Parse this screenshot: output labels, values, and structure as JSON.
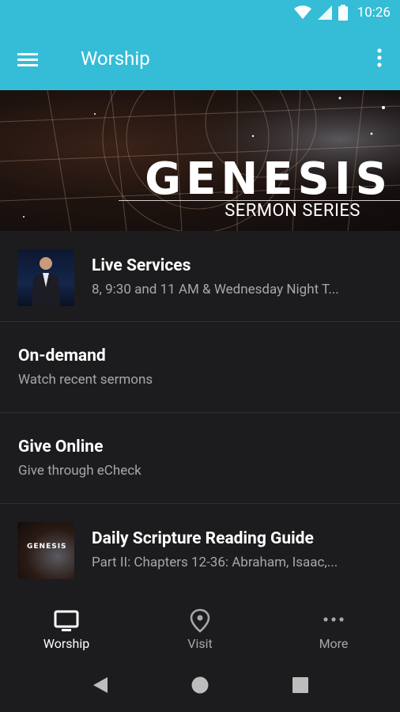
{
  "status_bar": {
    "time": "10:26"
  },
  "app_bar": {
    "title": "Worship"
  },
  "hero": {
    "title": "GENESIS",
    "subtitle": "SERMON SERIES"
  },
  "list": {
    "items": [
      {
        "title": "Live Services",
        "subtitle": "8, 9:30 and 11 AM & Wednesday Night T..."
      },
      {
        "title": "On-demand",
        "subtitle": "Watch recent sermons"
      },
      {
        "title": "Give Online",
        "subtitle": "Give through eCheck"
      },
      {
        "title": "Daily Scripture Reading Guide",
        "subtitle": "Part II: Chapters 12-36: Abraham, Isaac,...",
        "thumb_text": "GENESIS"
      }
    ]
  },
  "bottom_nav": {
    "items": [
      {
        "label": "Worship",
        "icon": "tv-icon",
        "active": true
      },
      {
        "label": "Visit",
        "icon": "location-pin-icon",
        "active": false
      },
      {
        "label": "More",
        "icon": "more-dots-icon",
        "active": false
      }
    ]
  },
  "colors": {
    "accent": "#35bcd6",
    "background": "#1c1c1e",
    "inactive": "#a7a7aa"
  }
}
